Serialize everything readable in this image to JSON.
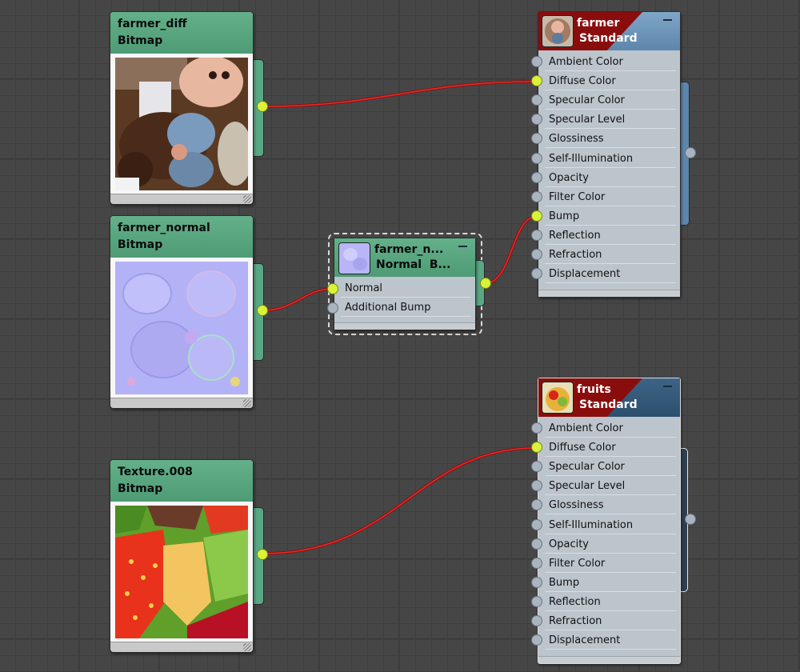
{
  "bitmap_nodes": [
    {
      "name": "farmer_diff",
      "type": "Bitmap",
      "thumb": "farmer-diffuse-texture"
    },
    {
      "name": "farmer_normal",
      "type": "Bitmap",
      "thumb": "farmer-normal-texture"
    },
    {
      "name": "Texture.008",
      "type": "Bitmap",
      "thumb": "fruits-diffuse-texture"
    }
  ],
  "normal_bump_node": {
    "title": "farmer_n...",
    "type": "Normal  B...",
    "inputs": [
      "Normal",
      "Additional Bump"
    ],
    "connected": [
      true,
      false
    ]
  },
  "materials": [
    {
      "name": "farmer",
      "type": "Standard",
      "icon": "farmer-material-icon",
      "slots": [
        "Ambient Color",
        "Diffuse Color",
        "Specular Color",
        "Specular Level",
        "Glossiness",
        "Self-Illumination",
        "Opacity",
        "Filter Color",
        "Bump",
        "Reflection",
        "Refraction",
        "Displacement"
      ],
      "connected": [
        false,
        true,
        false,
        false,
        false,
        false,
        false,
        false,
        true,
        false,
        false,
        false
      ]
    },
    {
      "name": "fruits",
      "type": "Standard",
      "icon": "fruits-material-icon",
      "slots": [
        "Ambient Color",
        "Diffuse Color",
        "Specular Color",
        "Specular Level",
        "Glossiness",
        "Self-Illumination",
        "Opacity",
        "Filter Color",
        "Bump",
        "Reflection",
        "Refraction",
        "Displacement"
      ],
      "connected": [
        false,
        true,
        false,
        false,
        false,
        false,
        false,
        false,
        false,
        false,
        false,
        false
      ]
    }
  ],
  "colors": {
    "bitmap_header": "#56a37e",
    "material_header": "#6f97bb",
    "material_header_selected": "#345a7b",
    "wire": "#e02a2a",
    "socket_connected": "#d9f23a",
    "socket_empty": "#aab4c1"
  }
}
